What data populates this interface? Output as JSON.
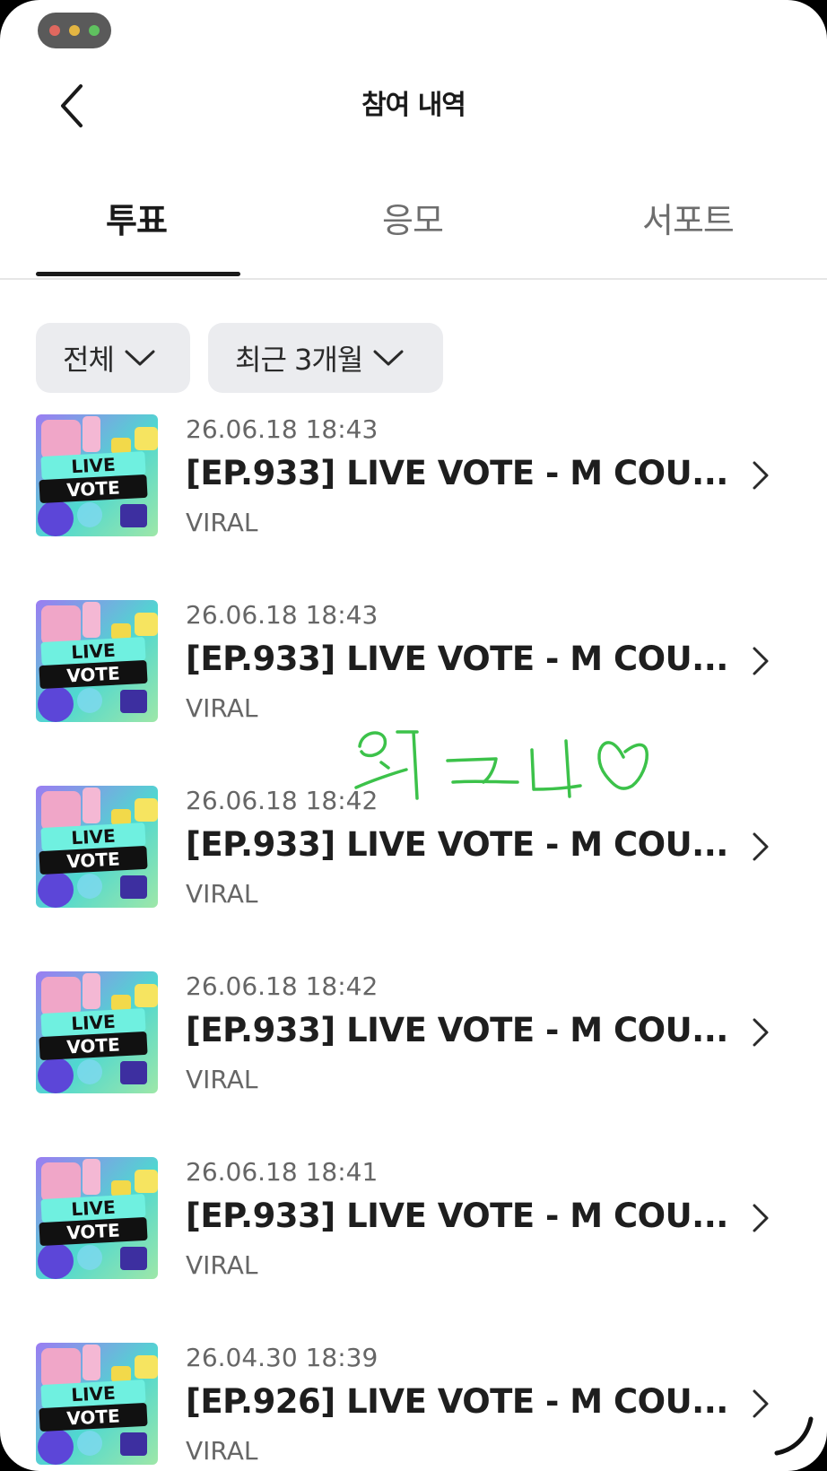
{
  "header": {
    "title": "참여 내역"
  },
  "tabs": [
    {
      "label": "투표",
      "active": true
    },
    {
      "label": "응모",
      "active": false
    },
    {
      "label": "서포트",
      "active": false
    }
  ],
  "filters": {
    "type": "전체",
    "period": "최근 3개월"
  },
  "items": [
    {
      "date": "26.06.18 18:43",
      "title": "[EP.933] LIVE VOTE - M COU...",
      "category": "VIRAL",
      "thumb_text": [
        "LIVE",
        "VOTE"
      ]
    },
    {
      "date": "26.06.18 18:43",
      "title": "[EP.933] LIVE VOTE - M COU...",
      "category": "VIRAL",
      "thumb_text": [
        "LIVE",
        "VOTE"
      ]
    },
    {
      "date": "26.06.18 18:42",
      "title": "[EP.933] LIVE VOTE - M COU...",
      "category": "VIRAL",
      "thumb_text": [
        "LIVE",
        "VOTE"
      ]
    },
    {
      "date": "26.06.18 18:42",
      "title": "[EP.933] LIVE VOTE - M COU...",
      "category": "VIRAL",
      "thumb_text": [
        "LIVE",
        "VOTE"
      ]
    },
    {
      "date": "26.06.18 18:41",
      "title": "[EP.933] LIVE VOTE - M COU...",
      "category": "VIRAL",
      "thumb_text": [
        "LIVE",
        "VOTE"
      ]
    },
    {
      "date": "26.04.30 18:39",
      "title": "[EP.926] LIVE VOTE - M COU...",
      "category": "VIRAL",
      "thumb_text": [
        "LIVE",
        "VOTE"
      ]
    }
  ],
  "handwriting": "위그니",
  "colors": {
    "window_dots": [
      "#e0685f",
      "#e3b542",
      "#5fc15f"
    ],
    "chip_bg": "#ebecef",
    "scribble": "#3cc24a"
  },
  "icons": {
    "back": "chevron-left-icon",
    "dropdown": "chevron-down-icon",
    "row": "chevron-right-icon"
  }
}
